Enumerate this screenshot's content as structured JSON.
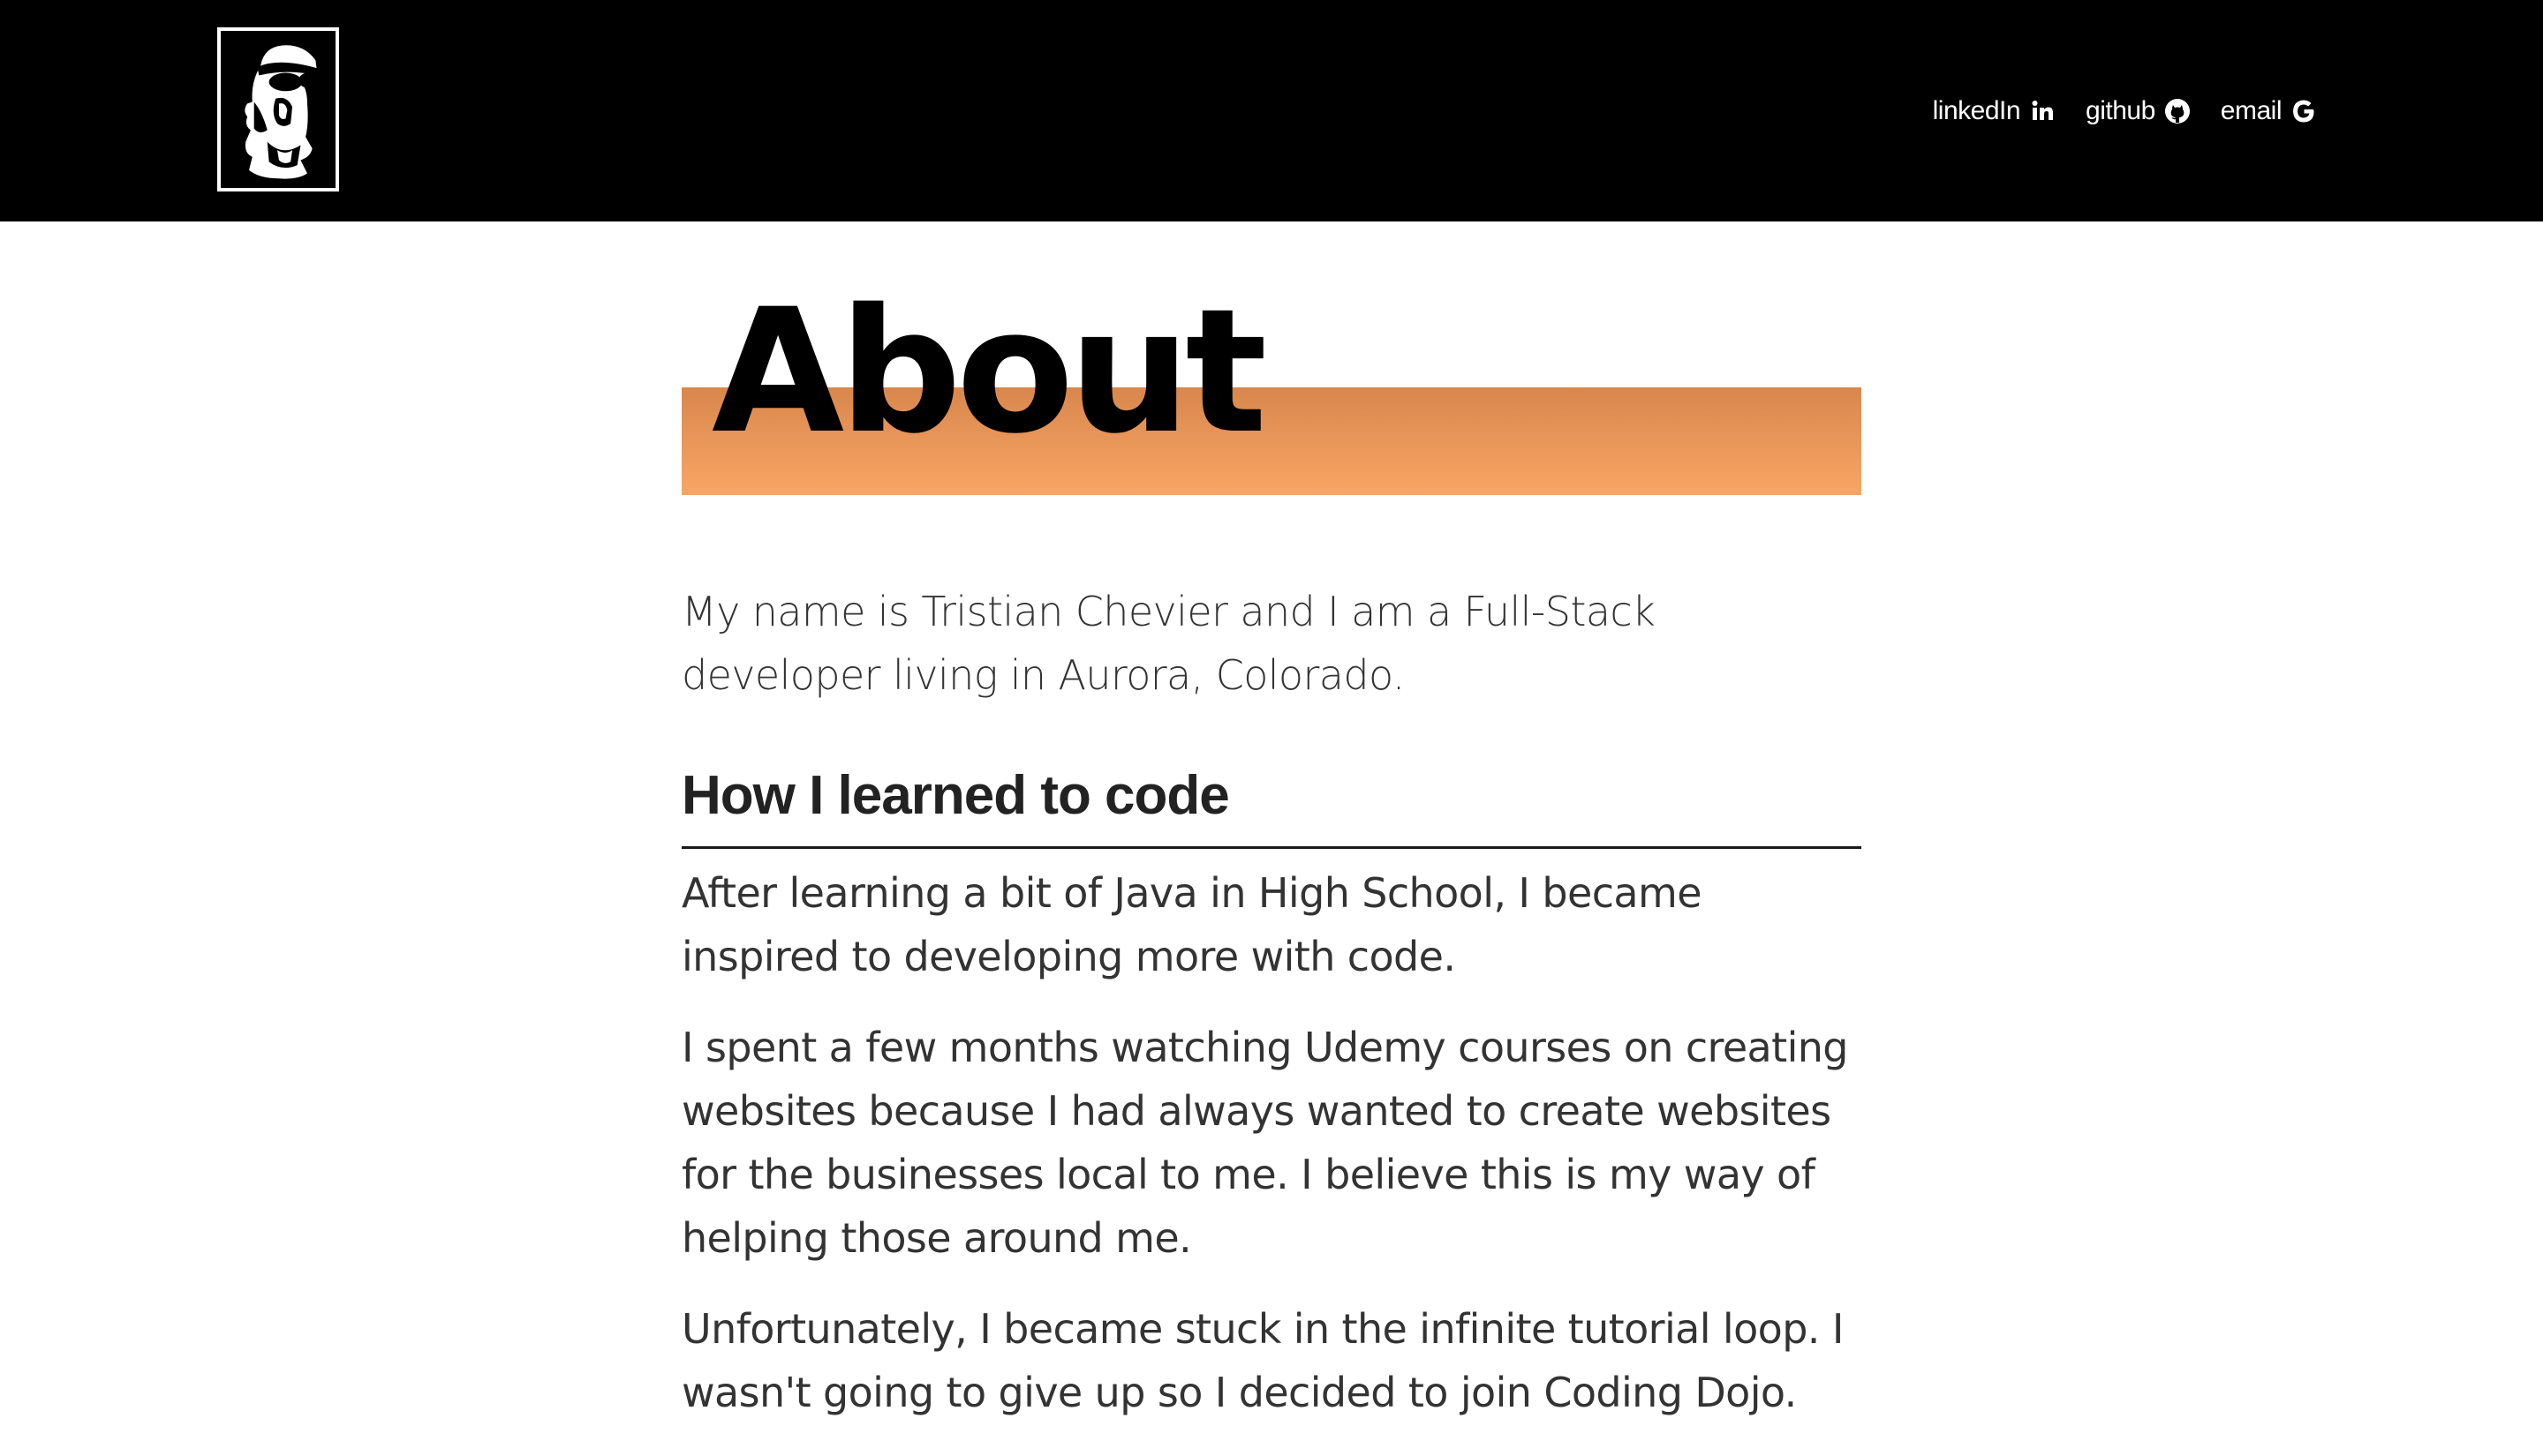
{
  "nav": {
    "links": [
      {
        "label": "linkedIn",
        "icon": "linkedin-icon"
      },
      {
        "label": "github",
        "icon": "github-icon"
      },
      {
        "label": "email",
        "icon": "google-icon"
      }
    ]
  },
  "page": {
    "title": "About",
    "intro": "My name is Tristian Chevier and I am a Full-Stack developer living in Aurora, Colorado.",
    "section_heading": "How I learned to code",
    "paragraphs": [
      "After learning a bit of Java in High School, I became inspired to developing more with code.",
      "I spent a few months watching Udemy courses on creating websites because I had always wanted to create websites for the businesses local to me. I believe this is my way of helping those around me.",
      "Unfortunately, I became stuck in the infinite tutorial loop. I wasn't going to give up so I decided to join Coding Dojo."
    ]
  },
  "colors": {
    "navbar_bg": "#000000",
    "accent_gradient_top": "#d8874d",
    "accent_gradient_bottom": "#f9a565",
    "text": "#333333"
  }
}
